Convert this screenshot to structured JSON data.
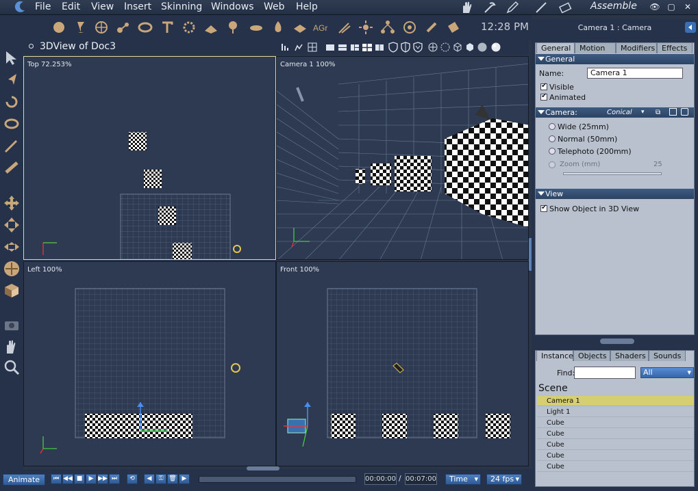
{
  "menubar": {
    "items": [
      "File",
      "Edit",
      "View",
      "Insert",
      "Skinning",
      "Windows",
      "Web",
      "Help"
    ],
    "room": "Assemble"
  },
  "toolbar": {
    "clock": "12:28 PM"
  },
  "view": {
    "title": "3DView of Doc3",
    "viewports": [
      {
        "label": "Top 72.253%"
      },
      {
        "label": "Camera 1 100%"
      },
      {
        "label": "Left 100%"
      },
      {
        "label": "Front 100%"
      }
    ]
  },
  "panel": {
    "title": "Camera 1 : Camera",
    "tabs": [
      "General",
      "Motion",
      "Modifiers",
      "Effects"
    ],
    "general_section": "General",
    "name_label": "Name:",
    "name_value": "Camera 1",
    "visible_label": "Visible",
    "animated_label": "Animated",
    "camera_section": "Camera:",
    "camera_type": "Conical",
    "lens_options": [
      "Wide (25mm)",
      "Normal (50mm)",
      "Telephoto (200mm)"
    ],
    "zoom_label": "Zoom (mm)",
    "zoom_value": "25",
    "view_section": "View",
    "show_object_label": "Show Object in 3D View"
  },
  "scene": {
    "tabs": [
      "Instances",
      "Objects",
      "Shaders",
      "Sounds"
    ],
    "find_label": "Find:",
    "find_filter": "All",
    "heading": "Scene",
    "rows": [
      "Camera 1",
      "Light 1",
      "Cube",
      "Cube",
      "Cube",
      "Cube",
      "Cube"
    ],
    "selected_row": "Camera 1"
  },
  "bottombar": {
    "animate_label": "Animate",
    "current_time": "00:00:00",
    "separator": "/",
    "end_time": "00:07:00",
    "time_mode": "Time",
    "fps": "24 fps"
  },
  "colors": {
    "background": "#2a3548",
    "viewport": "#2d3a52",
    "selected_row": "#d5ce72",
    "accent": "#3a6fb0"
  }
}
